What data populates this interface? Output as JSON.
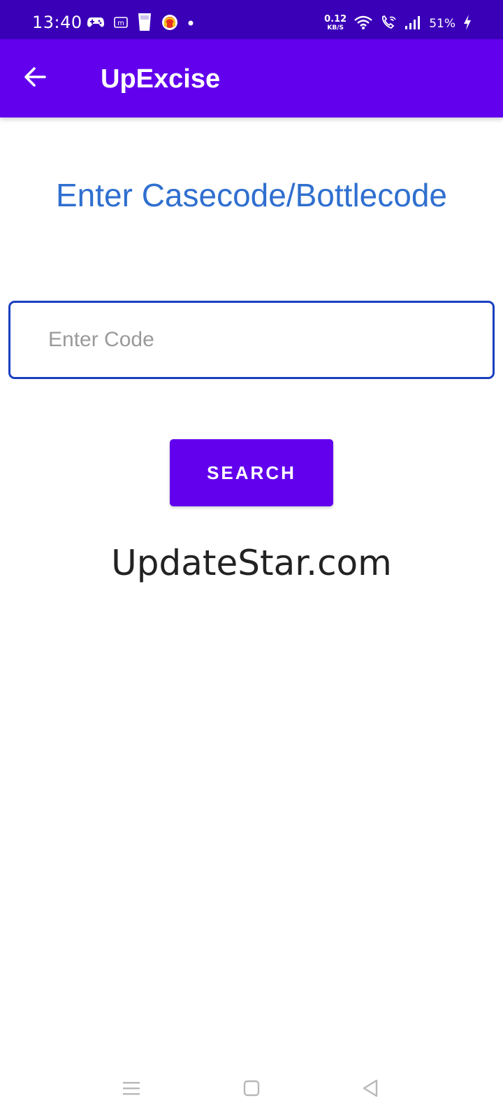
{
  "status_bar": {
    "time": "13:40",
    "net_speed_value": "0.12",
    "net_speed_unit": "KB/S",
    "battery": "51%",
    "icons_left": [
      "gamepad-icon",
      "m-app-icon",
      "glass-icon",
      "headset-icon",
      "dot-icon"
    ],
    "icons_right": [
      "wifi-icon",
      "wifi-calling-icon",
      "signal-icon",
      "charging-icon"
    ]
  },
  "app_bar": {
    "title": "UpExcise",
    "back_icon": "arrow-left-icon"
  },
  "main": {
    "heading": "Enter Casecode/Bottlecode",
    "code_input": {
      "value": "",
      "placeholder": "Enter Code"
    },
    "search_label": "SEARCH"
  },
  "watermark": "UpdateStar.com",
  "nav_bar": {
    "icons": [
      "menu-icon",
      "home-icon",
      "back-triangle-icon"
    ]
  },
  "colors": {
    "status_bar": "#3a00b8",
    "app_bar": "#6200ee",
    "heading": "#2f6fcf",
    "input_border": "#1a3fbf",
    "button": "#6200ee"
  }
}
